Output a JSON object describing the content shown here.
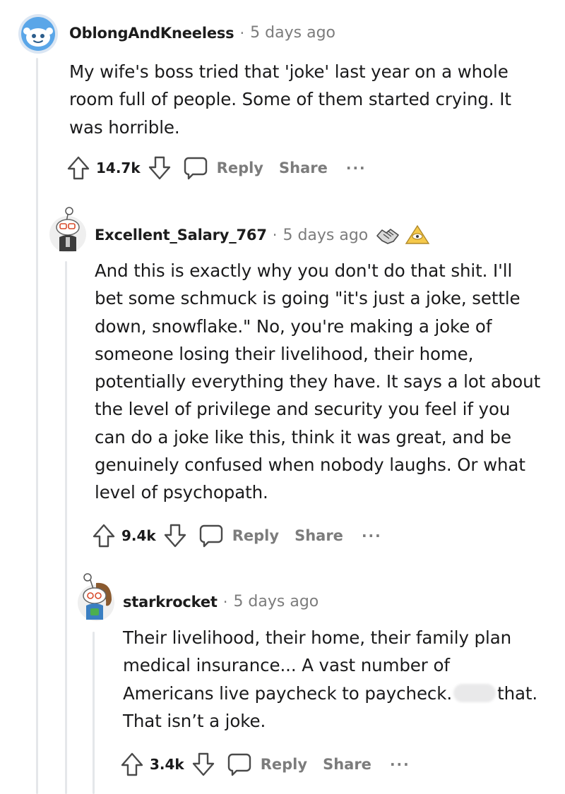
{
  "comments": [
    {
      "username": "OblongAndKneeless",
      "separator": "·",
      "time": "5 days ago",
      "lines": [
        "My wife's boss tried that 'joke' last year on a whole",
        "room full of people. Some of them started crying. It",
        "was horrible."
      ],
      "score": "14.7k",
      "reply_label": "Reply",
      "share_label": "Share",
      "more_label": "···"
    },
    {
      "username": "Excellent_Salary_767",
      "separator": "·",
      "time": "5 days ago",
      "lines": [
        "And this is exactly why you don't do that shit. I'll",
        "bet some schmuck is going \"it's just a joke, settle",
        "down, snowflake.\" No, you're making a joke of",
        "someone losing their livelihood, their home,",
        "potentially everything they have. It says a lot about",
        "the level of privilege and security you feel if you",
        "can do a joke like this, think it was great, and be",
        "genuinely confused when nobody laughs. Or what",
        "level of psychopath."
      ],
      "score": "9.4k",
      "reply_label": "Reply",
      "share_label": "Share",
      "more_label": "···"
    },
    {
      "username": "starkrocket",
      "separator": "·",
      "time": "5 days ago",
      "lines": [
        "Their livelihood, their home, their family plan",
        "medical insurance... A vast number of",
        "Americans live paycheck to paycheck.",
        "That isn’t a joke."
      ],
      "line3_tail": "that.",
      "score": "3.4k",
      "reply_label": "Reply",
      "share_label": "Share",
      "more_label": "···"
    }
  ]
}
